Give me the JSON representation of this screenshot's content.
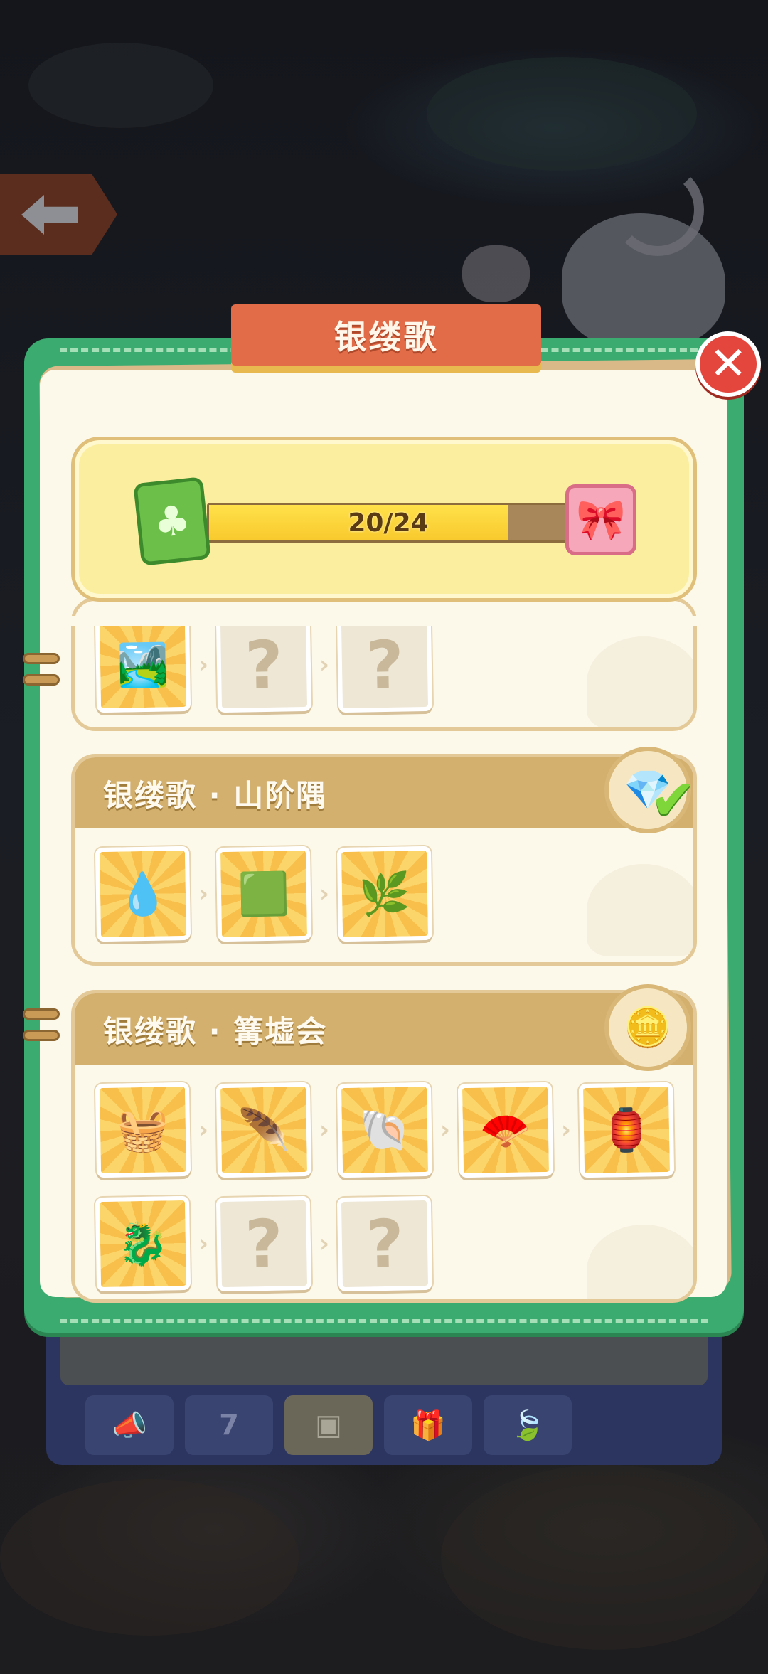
{
  "title": "银缕歌",
  "close_icon": "close-icon",
  "progress": {
    "current": 20,
    "total": 24,
    "label": "20/24",
    "left_icon": "clover-book-icon",
    "right_icon": "gift-box-icon"
  },
  "sections": [
    {
      "name": "",
      "items": [
        "garden-scene",
        "?",
        "?"
      ]
    },
    {
      "name": "银缕歌 · 山阶隅",
      "reward_icon": "diamond-icon",
      "claimed": true,
      "items": [
        "water-tile",
        "grass-steps",
        "plant-steps"
      ]
    },
    {
      "name": "银缕歌 · 篝墟会",
      "reward_icon": "gold-coin-icon",
      "claimed": false,
      "items": [
        "cloth-bundle",
        "feather-lyre",
        "shell-pouch",
        "purple-fan",
        "lantern-scroll",
        "dragon-toy",
        "?",
        "?"
      ]
    }
  ],
  "tabbar": {
    "tabs": [
      {
        "icon": "megaphone-icon",
        "label": ""
      },
      {
        "icon": "calendar-icon",
        "label": "7"
      },
      {
        "icon": "cards-icon",
        "label": ""
      },
      {
        "icon": "gift-icon",
        "label": ""
      },
      {
        "icon": "leaf-icon",
        "label": ""
      }
    ],
    "active_index": 2
  },
  "colors": {
    "panel_green": "#3bab70",
    "ribbon": "#e26b48",
    "progress_fill": "#f8c92d",
    "section_header": "#d4b06f"
  }
}
